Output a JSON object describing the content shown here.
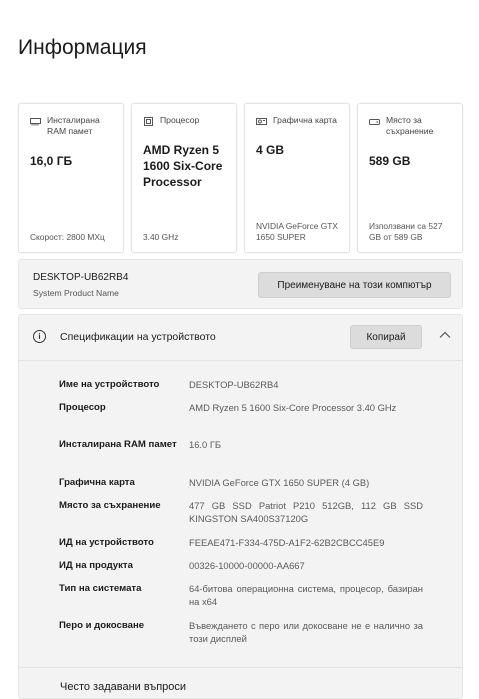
{
  "page": {
    "title": "Информация"
  },
  "cards": [
    {
      "icon": "ram-icon",
      "label": "Инсталирана RAM памет",
      "value": "16,0 ГБ",
      "sub": "Скорост: 2800 МХц"
    },
    {
      "icon": "processor-icon",
      "label": "Процесор",
      "value": "AMD Ryzen 5 1600 Six-Core Processor",
      "sub": "3.40 GHz"
    },
    {
      "icon": "graphics-card-icon",
      "label": "Графична карта",
      "value": "4 GB",
      "sub": "NVIDIA GeForce GTX 1650 SUPER"
    },
    {
      "icon": "storage-icon",
      "label": "Място за съхранение",
      "value": "589 GB",
      "sub": "Използвани са 527 GB от 589 GB"
    }
  ],
  "device": {
    "name": "DESKTOP-UB62RB4",
    "sub": "System Product Name",
    "rename_label": "Преименуване на този компютър"
  },
  "specs": {
    "title": "Спецификации на устройството",
    "copy_label": "Копирай",
    "rows": [
      {
        "key": "Име на устройството",
        "value": "DESKTOP-UB62RB4"
      },
      {
        "key": "Процесор",
        "value": "AMD Ryzen 5 1600 Six-Core Processor 3.40 GHz"
      },
      {
        "key": "Инсталирана RAM памет",
        "value": "16.0 ГБ"
      },
      {
        "key": "Графична карта",
        "value": "NVIDIA GeForce GTX 1650 SUPER (4 GB)"
      },
      {
        "key": "Място за съхранение",
        "value": "477 GB SSD Patriot P210 512GB, 112 GB SSD KINGSTON SA400S37120G"
      },
      {
        "key": "ИД на устройството",
        "value": "FEEAE471-F334-475D-A1F2-62B2CBCC45E9"
      },
      {
        "key": "ИД на продукта",
        "value": "00326-10000-00000-AA667"
      },
      {
        "key": "Тип на системата",
        "value": "64-битова операционна система, процесор, базиран на x64"
      },
      {
        "key": "Перо и докосване",
        "value": "Въвеждането с перо или докосване не е налично за този дисплей"
      }
    ]
  },
  "faq": {
    "label": "Често задавани въпроси"
  }
}
